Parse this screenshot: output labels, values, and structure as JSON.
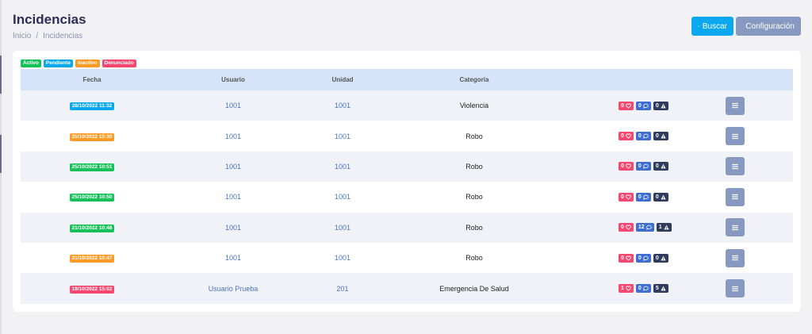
{
  "header": {
    "title": "Incidencias",
    "breadcrumb": [
      "Inicio",
      "Incidencias"
    ],
    "breadcrumb_separator": "/"
  },
  "actions": {
    "search_label": "Buscar",
    "config_label": "Configuración"
  },
  "legend": [
    {
      "label": "Activo",
      "color": "#16c15a"
    },
    {
      "label": "Pendiente",
      "color": "#0ba8f0"
    },
    {
      "label": "Inactivo",
      "color": "#ff9a26"
    },
    {
      "label": "Denunciado",
      "color": "#f5476f"
    }
  ],
  "table": {
    "columns": [
      "Fecha",
      "Usuario",
      "Unidad",
      "Categoría"
    ],
    "rows": [
      {
        "fecha": "28/10/2022 11:32",
        "status_color": "#0ba8f0",
        "usuario": "1001",
        "unidad": "1001",
        "categoria": "Violencia",
        "likes": "0",
        "comments": "0",
        "alerts": "0"
      },
      {
        "fecha": "25/10/2022 15:30",
        "status_color": "#ff9a26",
        "usuario": "1001",
        "unidad": "1001",
        "categoria": "Robo",
        "likes": "0",
        "comments": "0",
        "alerts": "0"
      },
      {
        "fecha": "25/10/2022 10:51",
        "status_color": "#16c15a",
        "usuario": "1001",
        "unidad": "1001",
        "categoria": "Robo",
        "likes": "0",
        "comments": "0",
        "alerts": "0"
      },
      {
        "fecha": "25/10/2022 10:50",
        "status_color": "#16c15a",
        "usuario": "1001",
        "unidad": "1001",
        "categoria": "Robo",
        "likes": "0",
        "comments": "0",
        "alerts": "0"
      },
      {
        "fecha": "21/10/2022 10:48",
        "status_color": "#16c15a",
        "usuario": "1001",
        "unidad": "1001",
        "categoria": "Robo",
        "likes": "0",
        "comments": "12",
        "alerts": "1"
      },
      {
        "fecha": "21/10/2022 10:47",
        "status_color": "#ff9a26",
        "usuario": "1001",
        "unidad": "1001",
        "categoria": "Robo",
        "likes": "0",
        "comments": "0",
        "alerts": "0"
      },
      {
        "fecha": "19/10/2022 15:02",
        "status_color": "#f5476f",
        "usuario": "Usuario Prueba",
        "unidad": "201",
        "categoria": "Emergencia De Salud",
        "likes": "1",
        "comments": "0",
        "alerts": "5"
      }
    ]
  },
  "icons": {
    "search": "search-icon",
    "config": "gears-icon",
    "like": "heart-icon",
    "comment": "comment-icon",
    "alert": "warning-icon",
    "menu": "bars-icon"
  }
}
